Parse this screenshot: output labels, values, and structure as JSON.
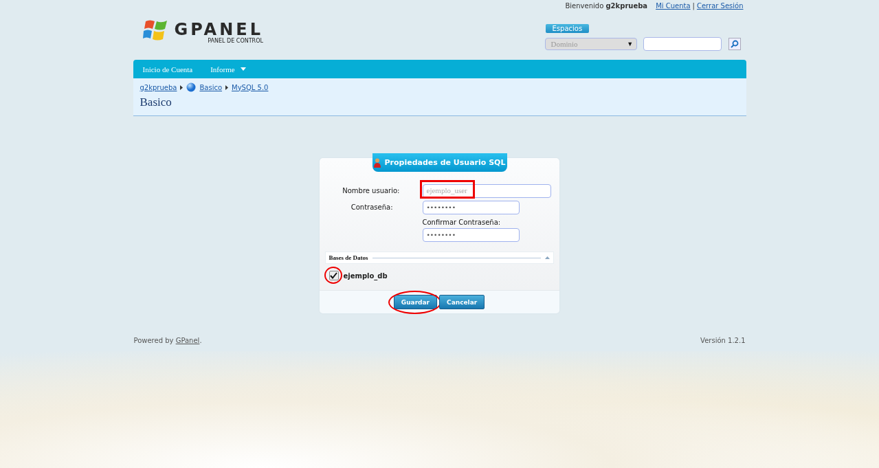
{
  "header": {
    "welcome": "Bienvenido",
    "username": "g2kprueba",
    "links": [
      "Mi Cuenta",
      "Cerrar Sesión"
    ],
    "separator": "|"
  },
  "logo": {
    "text": "GPANEL",
    "subtitle": "PANEL DE CONTROL"
  },
  "spaces": {
    "label": "Espacios",
    "dropdown": {
      "value": "Dominio",
      "arrow": "▼"
    }
  },
  "nav": [
    {
      "label": "Inicio de Cuenta",
      "has_menu": false
    },
    {
      "label": "Informe",
      "has_menu": true
    }
  ],
  "breadcrumb": [
    {
      "label": "g2kprueba",
      "icon": false
    },
    {
      "label": "Basico",
      "icon": true
    },
    {
      "label": "MySQL 5.0",
      "icon": false
    }
  ],
  "page_title": "Basico",
  "dialog": {
    "title": "Propiedades de Usuario SQL",
    "fields": [
      {
        "label": "Nombre usuario:",
        "placeholder": "ejemplo_user",
        "kind": "wide",
        "label_above": false,
        "highlighted": true
      },
      {
        "label": "Contraseña:",
        "value": "••••••••",
        "kind": "short",
        "label_above": false,
        "highlighted": false
      },
      {
        "label": "Confirmar Contraseña:",
        "value": "••••••••",
        "kind": "short",
        "label_above": true,
        "highlighted": false
      }
    ],
    "section": {
      "title": "Bases de Datos",
      "expanded": true
    },
    "databases": [
      {
        "name": "ejemplo_db",
        "checked": true,
        "highlighted": true
      }
    ],
    "buttons": [
      {
        "label": "Guardar",
        "highlighted": true
      },
      {
        "label": "Cancelar",
        "highlighted": false
      }
    ]
  },
  "footer": {
    "powered_by": "Powered by",
    "link": "GPanel",
    "period": ".",
    "version": "Versión 1.2.1"
  }
}
